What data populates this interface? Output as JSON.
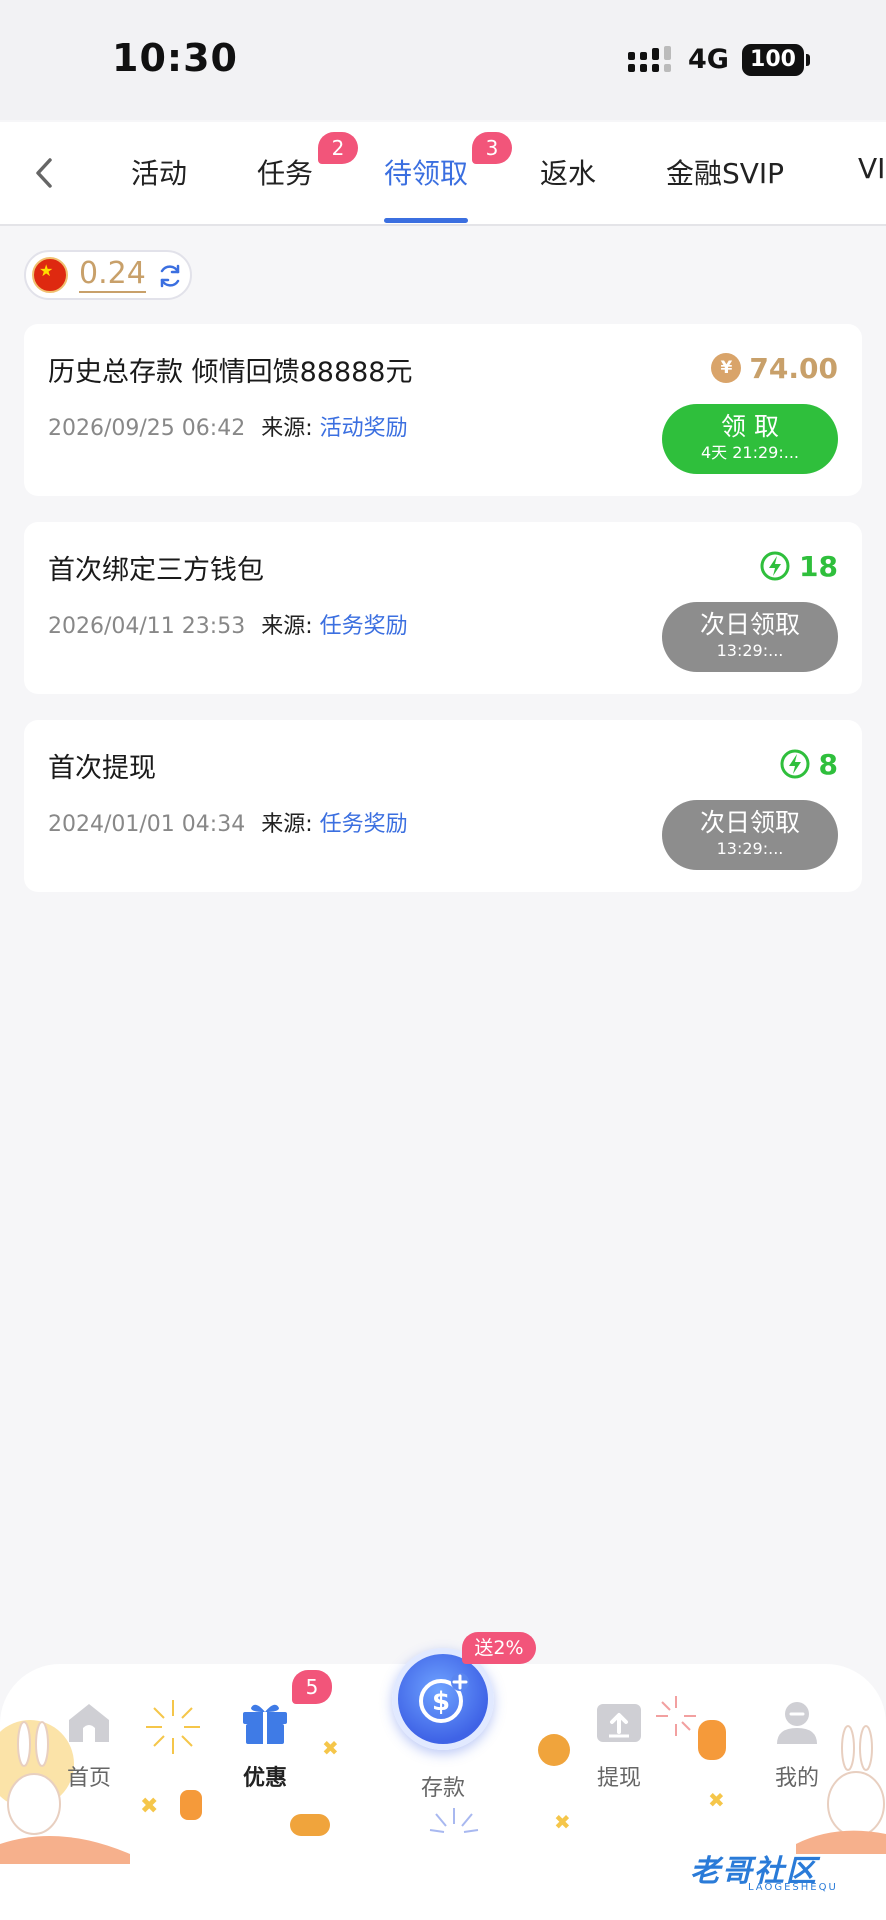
{
  "status_bar": {
    "time": "10:30",
    "network": "4G",
    "battery": "100"
  },
  "tabs": [
    {
      "label": "活动",
      "badge": ""
    },
    {
      "label": "任务",
      "badge": "2"
    },
    {
      "label": "待领取",
      "badge": "3",
      "active": true
    },
    {
      "label": "返水",
      "badge": ""
    },
    {
      "label": "金融SVIP",
      "badge": ""
    },
    {
      "label": "VI",
      "badge": ""
    }
  ],
  "balance": {
    "value": "0.24"
  },
  "rewards": [
    {
      "title": "历史总存款 倾情回馈88888元",
      "date": "2026/09/25 06:42",
      "source_label": "来源:",
      "source": "活动奖励",
      "amount": "74.00",
      "amount_type": "coin",
      "button_label": "领 取",
      "button_sub": "4天 21:29:...",
      "button_state": "active"
    },
    {
      "title": "首次绑定三方钱包",
      "date": "2026/04/11 23:53",
      "source_label": "来源:",
      "source": "任务奖励",
      "amount": "18",
      "amount_type": "energy",
      "button_label": "次日领取",
      "button_sub": "13:29:...",
      "button_state": "disabled"
    },
    {
      "title": "首次提现",
      "date": "2024/01/01 04:34",
      "source_label": "来源:",
      "source": "任务奖励",
      "amount": "8",
      "amount_type": "energy",
      "button_label": "次日领取",
      "button_sub": "13:29:...",
      "button_state": "disabled"
    }
  ],
  "bottom_nav": {
    "items": [
      {
        "label": "首页",
        "icon": "home-icon"
      },
      {
        "label": "优惠",
        "icon": "gift-icon",
        "badge": "5",
        "active": true
      },
      {
        "label": "存款",
        "icon": "deposit-icon",
        "promo": "送2%"
      },
      {
        "label": "提现",
        "icon": "withdraw-icon"
      },
      {
        "label": "我的",
        "icon": "profile-icon"
      }
    ]
  },
  "watermark": {
    "text": "老哥社区",
    "sub": "LAOGESHEQU"
  },
  "colors": {
    "accent": "#3b6fe0",
    "claim_green": "#2fbf3c",
    "disabled_gray": "#8d8d8d",
    "badge_pink": "#f2557a",
    "gold": "#c8a06a"
  }
}
